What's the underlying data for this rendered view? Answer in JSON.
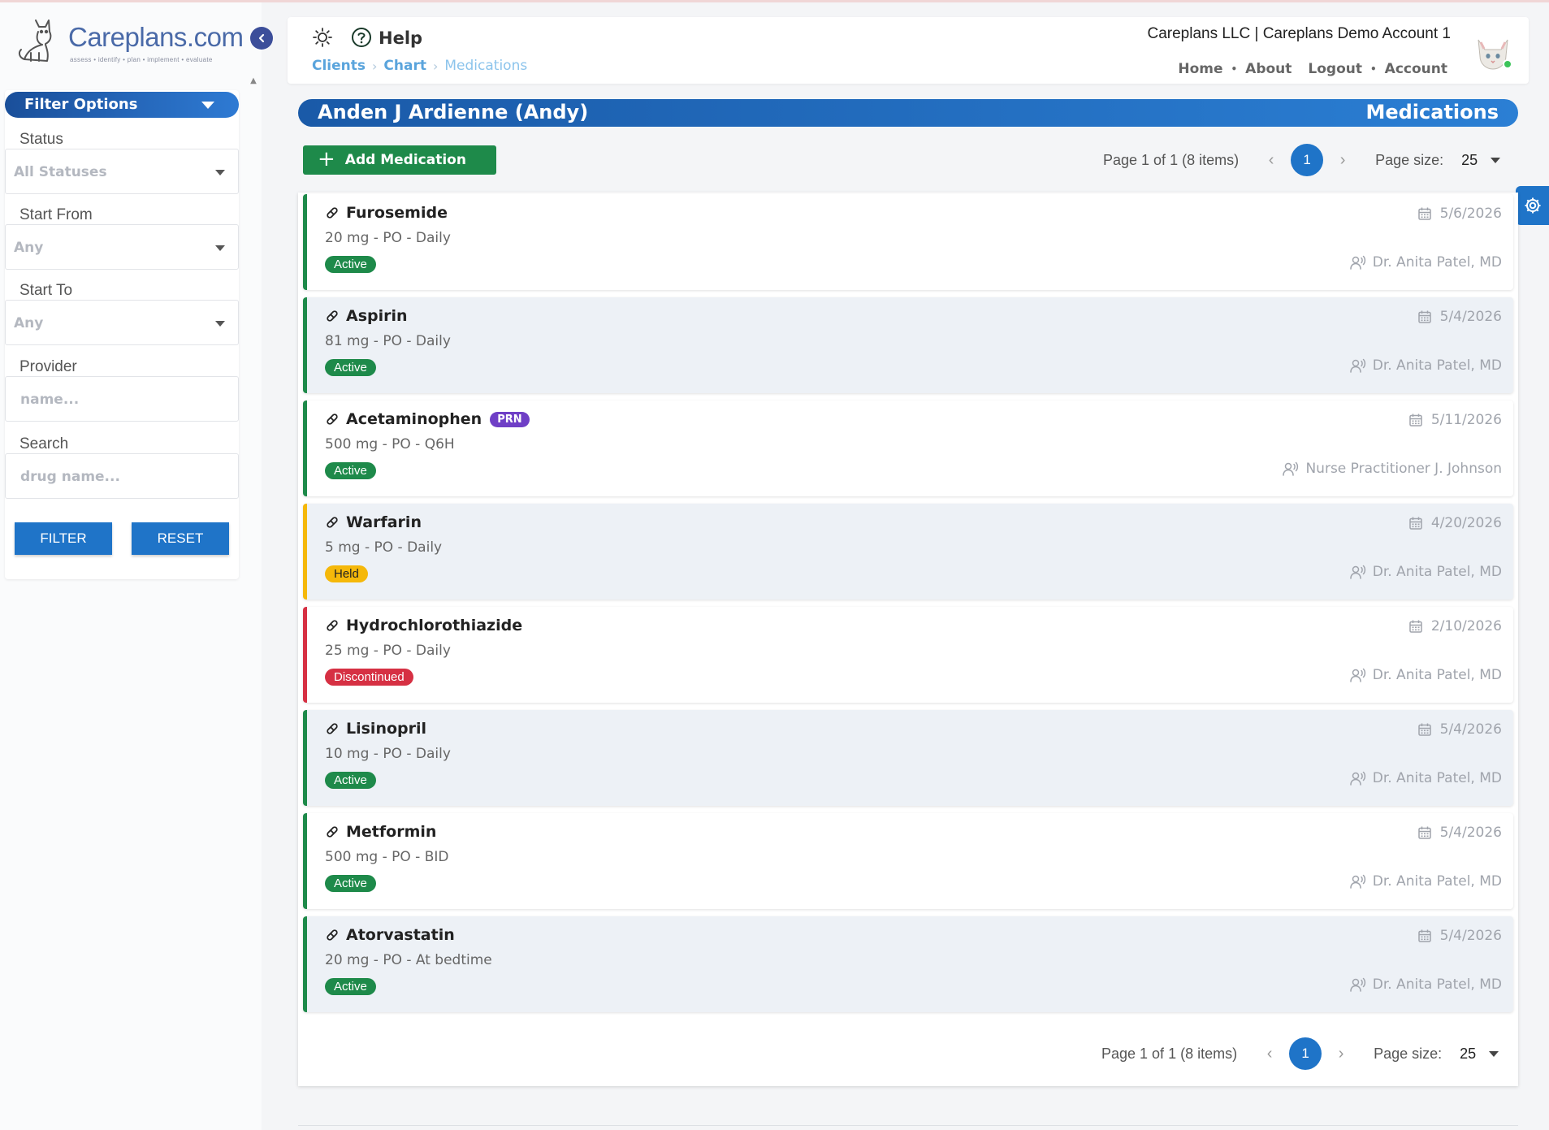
{
  "brand": {
    "logo_word": "Careplans.com",
    "logo_tagline": "assess • identify • plan • implement • evaluate"
  },
  "filter": {
    "header": "Filter Options",
    "status": {
      "label": "Status",
      "value": "All Statuses"
    },
    "start_from": {
      "label": "Start From",
      "value": "Any"
    },
    "start_to": {
      "label": "Start To",
      "value": "Any"
    },
    "provider": {
      "label": "Provider",
      "placeholder": "name..."
    },
    "search": {
      "label": "Search",
      "placeholder": "drug name..."
    },
    "filter_button": "FILTER",
    "reset_button": "RESET"
  },
  "header": {
    "help_label": "Help",
    "breadcrumbs": [
      "Clients",
      "Chart",
      "Medications"
    ],
    "account_title": "Careplans LLC | Careplans Demo Account 1",
    "nav": {
      "home": "Home",
      "about": "About",
      "logout": "Logout",
      "account": "Account"
    }
  },
  "page": {
    "patient_name": "Anden J Ardienne (Andy)",
    "section_title": "Medications",
    "add_button": "Add Medication"
  },
  "pager": {
    "info": "Page 1 of 1 (8 items)",
    "current_page": "1",
    "size_label": "Page size:",
    "size_value": "25"
  },
  "medications": [
    {
      "name": "Furosemide",
      "dose": "20 mg - PO - Daily",
      "status": "Active",
      "status_key": "active",
      "date": "5/6/2026",
      "provider": "Dr. Anita Patel, MD",
      "prn": ""
    },
    {
      "name": "Aspirin",
      "dose": "81 mg - PO - Daily",
      "status": "Active",
      "status_key": "active",
      "date": "5/4/2026",
      "provider": "Dr. Anita Patel, MD",
      "prn": ""
    },
    {
      "name": "Acetaminophen",
      "dose": "500 mg - PO - Q6H",
      "status": "Active",
      "status_key": "active",
      "date": "5/11/2026",
      "provider": "Nurse Practitioner J. Johnson",
      "prn": "PRN"
    },
    {
      "name": "Warfarin",
      "dose": "5 mg - PO - Daily",
      "status": "Held",
      "status_key": "held",
      "date": "4/20/2026",
      "provider": "Dr. Anita Patel, MD",
      "prn": ""
    },
    {
      "name": "Hydrochlorothiazide",
      "dose": "25 mg - PO - Daily",
      "status": "Discontinued",
      "status_key": "discontinued",
      "date": "2/10/2026",
      "provider": "Dr. Anita Patel, MD",
      "prn": ""
    },
    {
      "name": "Lisinopril",
      "dose": "10 mg - PO - Daily",
      "status": "Active",
      "status_key": "active",
      "date": "5/4/2026",
      "provider": "Dr. Anita Patel, MD",
      "prn": ""
    },
    {
      "name": "Metformin",
      "dose": "500 mg - PO - BID",
      "status": "Active",
      "status_key": "active",
      "date": "5/4/2026",
      "provider": "Dr. Anita Patel, MD",
      "prn": ""
    },
    {
      "name": "Atorvastatin",
      "dose": "20 mg - PO - At bedtime",
      "status": "Active",
      "status_key": "active",
      "date": "5/4/2026",
      "provider": "Dr. Anita Patel, MD",
      "prn": ""
    }
  ],
  "colors": {
    "brand_blue": "#1f74c8",
    "active_green": "#1e8a4a",
    "held_yellow": "#f5b80a",
    "discontinued_red": "#d63043",
    "prn_purple": "#6f3fc6"
  },
  "icons": {
    "theme": "sun-icon",
    "help": "help-circle-icon",
    "medication": "pill-icon",
    "date": "calendar-icon",
    "provider": "person-voice-icon",
    "settings": "gear-icon",
    "collapse": "chevron-left-icon"
  }
}
